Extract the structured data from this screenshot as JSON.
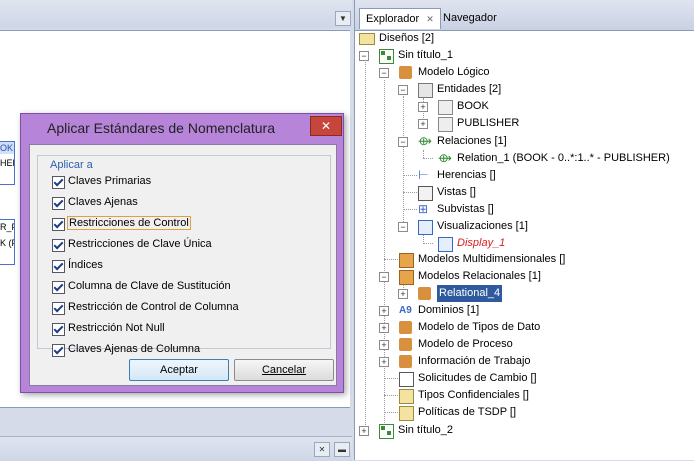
{
  "left_pane": {
    "fragments": [
      "OK",
      "HER",
      "R_PU",
      "K (PU"
    ]
  },
  "explorer": {
    "tabs": [
      {
        "label": "Explorador",
        "active": true
      },
      {
        "label": "Navegador",
        "active": false
      }
    ],
    "tree": {
      "disenos": "Diseños [2]",
      "sin_titulo_1": "Sin título_1",
      "modelo_logico": "Modelo Lógico",
      "entidades": "Entidades [2]",
      "book": "BOOK",
      "publisher": "PUBLISHER",
      "relaciones": "Relaciones [1]",
      "relation_1": "Relation_1 (BOOK - 0..*:1..* - PUBLISHER)",
      "herencias": "Herencias []",
      "vistas": "Vistas []",
      "subvistas": "Subvistas []",
      "visualizaciones": "Visualizaciones [1]",
      "display_1": "Display_1",
      "modelos_multidimensionales": "Modelos Multidimensionales []",
      "modelos_relacionales": "Modelos Relacionales [1]",
      "relational_4": "Relational_4",
      "dominios": "Dominios [1]",
      "modelo_tipos_dato": "Modelo de Tipos de Dato",
      "modelo_proceso": "Modelo de Proceso",
      "informacion_trabajo": "Información de Trabajo",
      "solicitudes_cambio": "Solicitudes de Cambio []",
      "tipos_confidenciales": "Tipos Confidenciales []",
      "politicas_tsdp": "Políticas de TSDP []",
      "sin_titulo_2": "Sin título_2"
    }
  },
  "dialog": {
    "title": "Aplicar Estándares de Nomenclatura",
    "group_label": "Aplicar a",
    "options": [
      {
        "label": "Claves Primarias",
        "checked": true
      },
      {
        "label": "Claves Ajenas",
        "checked": true
      },
      {
        "label": "Restricciones de Control",
        "checked": true
      },
      {
        "label": "Restricciones de Clave Única",
        "checked": true
      },
      {
        "label": "Índices",
        "checked": true
      },
      {
        "label": "Columna de Clave de Sustitución",
        "checked": true
      },
      {
        "label": "Restricción de Control de Columna",
        "checked": true
      },
      {
        "label": "Restricción Not Null",
        "checked": true
      },
      {
        "label": "Claves Ajenas de Columna",
        "checked": true
      }
    ],
    "accept_label": "Aceptar",
    "cancel_label": "Cancelar"
  },
  "colors": {
    "dialog_frame": "#b684d8",
    "selection": "#2f5b9e",
    "display_text": "#d81e1e",
    "close_button": "#c7463b"
  }
}
